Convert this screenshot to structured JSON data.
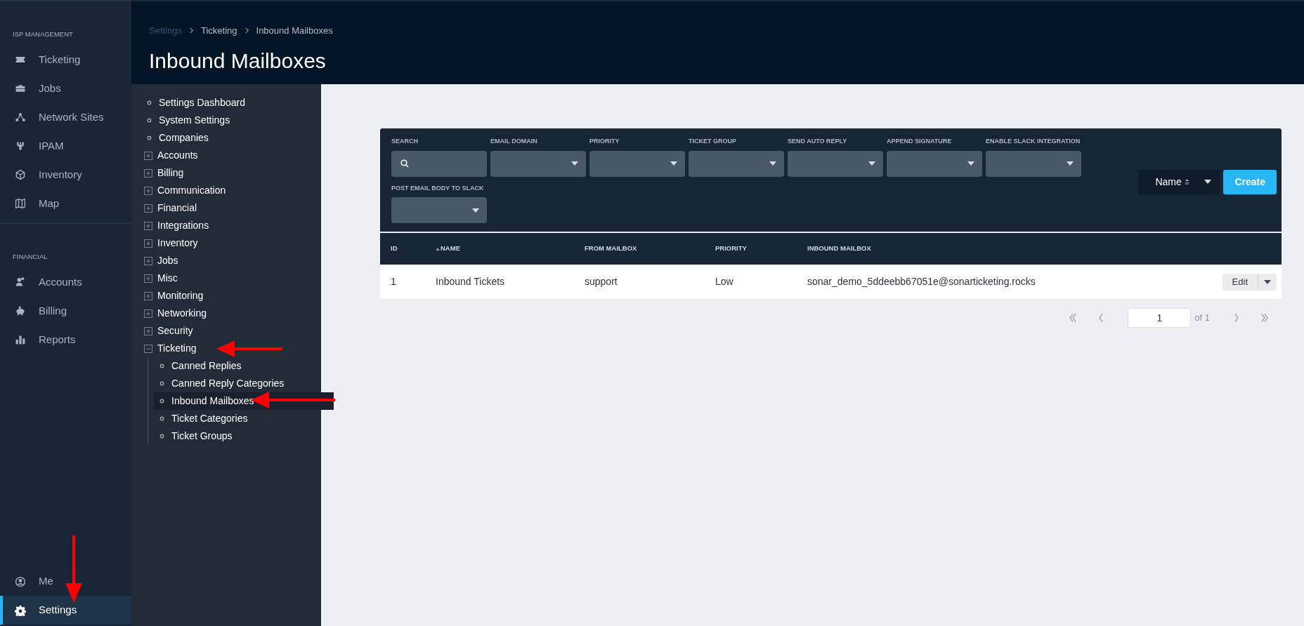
{
  "sidebar": {
    "sections": [
      {
        "title": "ISP MANAGEMENT",
        "items": [
          {
            "label": "Ticketing",
            "kind": "ticket",
            "selected": false
          },
          {
            "label": "Jobs",
            "kind": "briefcase",
            "selected": false
          },
          {
            "label": "Network Sites",
            "kind": "network",
            "selected": false
          },
          {
            "label": "IPAM",
            "kind": "ipam",
            "selected": false
          },
          {
            "label": "Inventory",
            "kind": "cube",
            "selected": false
          },
          {
            "label": "Map",
            "kind": "map",
            "selected": false
          }
        ]
      },
      {
        "title": "FINANCIAL",
        "items": [
          {
            "label": "Accounts",
            "kind": "users",
            "selected": false
          },
          {
            "label": "Billing",
            "kind": "piggy",
            "selected": false
          },
          {
            "label": "Reports",
            "kind": "bars",
            "selected": false
          }
        ]
      }
    ],
    "bottom_items": [
      {
        "label": "Me",
        "kind": "user",
        "selected": false
      },
      {
        "label": "Settings",
        "kind": "gear",
        "selected": true
      }
    ]
  },
  "header": {
    "breadcrumbs": [
      "Settings",
      "Ticketing",
      "Inbound Mailboxes"
    ],
    "title": "Inbound Mailboxes"
  },
  "settings_tree": [
    {
      "label": "Settings Dashboard",
      "kind": "leaf",
      "selected": false
    },
    {
      "label": "System Settings",
      "kind": "leaf",
      "selected": false
    },
    {
      "label": "Companies",
      "kind": "leaf",
      "selected": false
    },
    {
      "label": "Accounts",
      "kind": "folder",
      "expanded": false
    },
    {
      "label": "Billing",
      "kind": "folder",
      "expanded": false
    },
    {
      "label": "Communication",
      "kind": "folder",
      "expanded": false
    },
    {
      "label": "Financial",
      "kind": "folder",
      "expanded": false
    },
    {
      "label": "Integrations",
      "kind": "folder",
      "expanded": false
    },
    {
      "label": "Inventory",
      "kind": "folder",
      "expanded": false
    },
    {
      "label": "Jobs",
      "kind": "folder",
      "expanded": false
    },
    {
      "label": "Misc",
      "kind": "folder",
      "expanded": false
    },
    {
      "label": "Monitoring",
      "kind": "folder",
      "expanded": false
    },
    {
      "label": "Networking",
      "kind": "folder",
      "expanded": false
    },
    {
      "label": "Security",
      "kind": "folder",
      "expanded": false
    },
    {
      "label": "Ticketing",
      "kind": "folder",
      "expanded": true,
      "children": [
        {
          "label": "Canned Replies",
          "selected": false
        },
        {
          "label": "Canned Reply Categories",
          "selected": false
        },
        {
          "label": "Inbound Mailboxes",
          "selected": true
        },
        {
          "label": "Ticket Categories",
          "selected": false
        },
        {
          "label": "Ticket Groups",
          "selected": false
        }
      ]
    }
  ],
  "filters": [
    {
      "label": "SEARCH",
      "kind": "search"
    },
    {
      "label": "EMAIL DOMAIN",
      "kind": "select"
    },
    {
      "label": "PRIORITY",
      "kind": "select"
    },
    {
      "label": "TICKET GROUP",
      "kind": "select"
    },
    {
      "label": "SEND AUTO REPLY",
      "kind": "select"
    },
    {
      "label": "APPEND SIGNATURE",
      "kind": "select"
    },
    {
      "label": "ENABLE SLACK INTEGRATION",
      "kind": "select"
    },
    {
      "label": "POST EMAIL BODY TO SLACK",
      "kind": "select"
    }
  ],
  "sort": {
    "value": "Name"
  },
  "create_button": "Create",
  "table": {
    "columns": [
      {
        "label": "ID",
        "sorted": false
      },
      {
        "label": "NAME",
        "sorted": true
      },
      {
        "label": "FROM MAILBOX",
        "sorted": false
      },
      {
        "label": "PRIORITY",
        "sorted": false
      },
      {
        "label": "INBOUND MAILBOX",
        "sorted": false
      }
    ],
    "rows": [
      {
        "cells": [
          "1",
          "Inbound Tickets",
          "support",
          "Low",
          "sonar_demo_5ddeebb67051e@sonarticketing.rocks"
        ],
        "action": "Edit"
      }
    ]
  },
  "pagination": {
    "page": "1",
    "of": "of 1"
  }
}
